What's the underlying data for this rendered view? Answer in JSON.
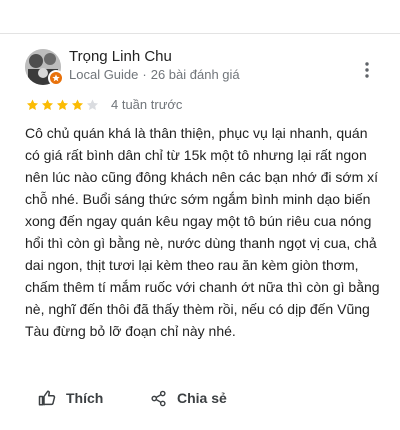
{
  "review": {
    "reviewer": {
      "name": "Trọng Linh Chu",
      "badge": "Local Guide",
      "separator": "·",
      "review_count": "26 bài đánh giá"
    },
    "rating": 4,
    "max_rating": 5,
    "date": "4 tuần trước",
    "text": "Cô chủ quán khá là thân thiện, phục vụ lại nhanh, quán có giá rất bình dân chỉ từ 15k một tô nhưng lại rất ngon nên lúc nào cũng đông khách nên các bạn nhớ đi sớm xí chỗ nhé. Buổi sáng thức sớm ngắm bình minh dạo biến xong đến ngay quán kêu ngay một tô bún riêu cua nóng hổi thì còn gì bằng nè, nước dùng thanh ngọt vị cua, chả dai ngon, thịt tươi lại kèm theo rau ăn kèm giòn thơm, chấm thêm tí mắm ruốc với chanh ớt nữa thì còn gì bằng nè, nghĩ đến thôi đã thấy thèm rồi, nếu có dịp đến Vũng Tàu đừng bỏ lỡ đoạn chỉ này nhé."
  },
  "actions": {
    "like_label": "Thích",
    "share_label": "Chia sẻ"
  },
  "colors": {
    "star_filled": "#fbbc04",
    "star_empty": "#dadce0",
    "badge": "#e8710a"
  },
  "icons": {
    "more": "more-vert-icon",
    "like": "thumb-up-icon",
    "share": "share-icon",
    "badge": "local-guide-star-icon"
  }
}
